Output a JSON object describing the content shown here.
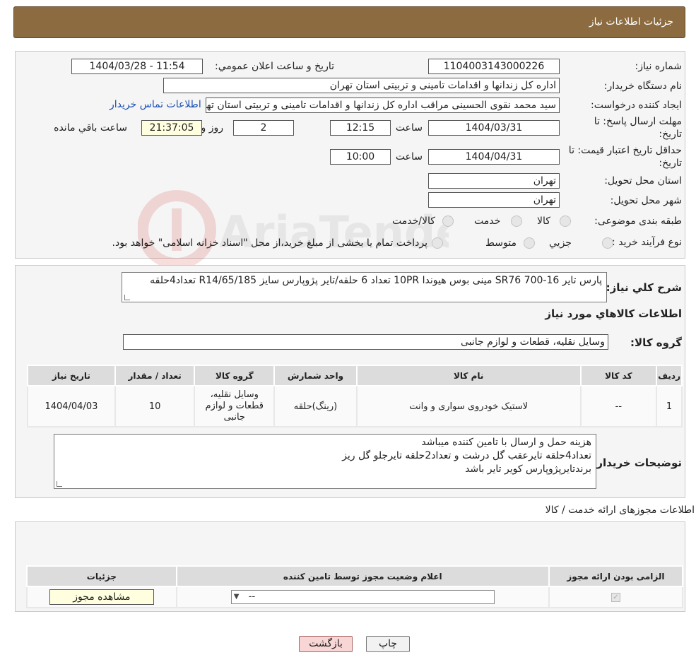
{
  "header": {
    "title": "جزئیات اطلاعات نیاز"
  },
  "info": {
    "need_number_label": "شماره نیاز:",
    "need_number": "1104003143000226",
    "announce_label": "تاریخ و ساعت اعلان عمومي:",
    "announce_value": "1404/03/28 - 11:54",
    "buyer_org_label": "نام دستگاه خریدار:",
    "buyer_org": "اداره کل زندانها و اقدامات تامینی و تربیتی استان تهران",
    "creator_label": "ایجاد کننده درخواست:",
    "creator": "سید محمد نقوی الحسینی مراقب  اداره کل زندانها و اقدامات تامینی و تربیتی استان تهران",
    "contact_link": "اطلاعات تماس خریدار",
    "deadline_label_1": "مهلت ارسال پاسخ: تا",
    "deadline_label_2": "تاریخ:",
    "deadline_date": "1404/03/31",
    "time_label": "ساعت",
    "deadline_time": "12:15",
    "days_value": "2",
    "days_label": "روز و",
    "remaining_time": "21:37:05",
    "remaining_label": "ساعت باقي مانده",
    "validity_label_1": "حداقل تاریخ اعتبار قیمت: تا",
    "validity_label_2": "تاریخ:",
    "validity_date": "1404/04/31",
    "validity_time_label": "ساعت",
    "validity_time": "10:00",
    "province_label": "استان محل تحویل:",
    "province": "تهران",
    "city_label": "شهر محل تحویل:",
    "city": "تهران",
    "category_label": "طبقه بندی موضوعی:",
    "category_options": [
      "کالا",
      "خدمت",
      "کالا/خدمت"
    ],
    "process_label": "نوع فرآیند خرید :",
    "process_options": [
      "جزيي",
      "متوسط"
    ],
    "process_note": "پرداخت تمام یا بخشی از مبلغ خرید،از محل \"اسناد خزانه اسلامی\" خواهد بود."
  },
  "summary": {
    "desc_label": "شرح کلي نیاز:",
    "desc_value": "پارس تایر 16-700 SR76  مینی بوس هیوندا 10PR تعداد 6 حلقه/تایر پژوپارس سایز R14/65/185 تعداد4حلقه",
    "goods_info_title": "اطلاعات کالاهاي مورد نیاز",
    "group_label": "گروه کالا:",
    "group_value": "وسایل نقلیه، قطعات و لوازم جانبی",
    "table_headers": [
      "رديف",
      "کد کالا",
      "نام کالا",
      "واحد شمارش",
      "گروه کالا",
      "تعداد / مقدار",
      "تاریخ نیاز"
    ],
    "rows": [
      [
        "1",
        "--",
        "لاستیک خودروی سواری و وانت",
        "(رینگ)حلقه",
        "وسایل نقلیه، قطعات و لوازم جانبی",
        "10",
        "1404/04/03"
      ]
    ],
    "buyer_notes_label": "توضیحات خریدار:",
    "buyer_notes": [
      "هزینه حمل و ارسال با تامین کننده میباشد",
      "تعداد4حلقه تایرعقب گل درشت و تعداد2حلقه تایرجلو گل ریز",
      "برندتایرپژوپارس کویر تایر باشد"
    ]
  },
  "license": {
    "title": "اطلاعات مجوزهای ارائه خدمت / کالا",
    "headers": [
      "الزامی بودن ارائه مجوز",
      "اعلام وضعیت مجوز توسط تامین کننده",
      "جزئیات"
    ],
    "select_value": "--",
    "view_button": "مشاهده مجوز"
  },
  "footer": {
    "print": "چاپ",
    "back": "بازگشت"
  },
  "watermark_text": "AriaTender.neT",
  "colors": {
    "header_bg": "#8b6b3f",
    "link": "#1a4fb5",
    "back_button_bg": "#f9d6d6"
  }
}
